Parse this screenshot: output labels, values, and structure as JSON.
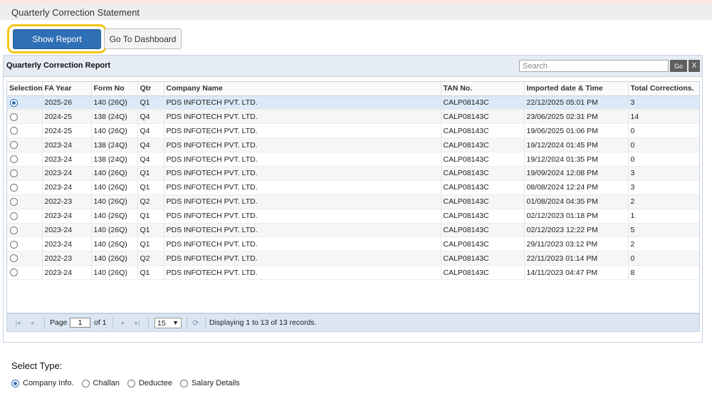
{
  "page": {
    "title": "Quarterly Correction Statement"
  },
  "toolbar": {
    "show_report": "Show Report",
    "go_dashboard": "Go To Dashboard"
  },
  "panel": {
    "title": "Quarterly Correction Report",
    "search_placeholder": "Search",
    "go_label": "Go",
    "clear_label": "X"
  },
  "table": {
    "columns": [
      "Selection",
      "FA Year",
      "Form No",
      "Qtr",
      "Company Name",
      "TAN No.",
      "Imported date & Time",
      "Total Corrections."
    ],
    "rows": [
      {
        "selected": true,
        "fa_year": "2025-26",
        "form_no": "140 (26Q)",
        "qtr": "Q1",
        "company": "PDS INFOTECH PVT. LTD.",
        "tan": "CALP08143C",
        "imported": "22/12/2025 05:01 PM",
        "total": "3"
      },
      {
        "selected": false,
        "fa_year": "2024-25",
        "form_no": "138 (24Q)",
        "qtr": "Q4",
        "company": "PDS INFOTECH PVT. LTD.",
        "tan": "CALP08143C",
        "imported": "23/06/2025 02:31 PM",
        "total": "14"
      },
      {
        "selected": false,
        "fa_year": "2024-25",
        "form_no": "140 (26Q)",
        "qtr": "Q4",
        "company": "PDS INFOTECH PVT. LTD.",
        "tan": "CALP08143C",
        "imported": "19/06/2025 01:06 PM",
        "total": "0"
      },
      {
        "selected": false,
        "fa_year": "2023-24",
        "form_no": "138 (24Q)",
        "qtr": "Q4",
        "company": "PDS INFOTECH PVT. LTD.",
        "tan": "CALP08143C",
        "imported": "19/12/2024 01:45 PM",
        "total": "0"
      },
      {
        "selected": false,
        "fa_year": "2023-24",
        "form_no": "138 (24Q)",
        "qtr": "Q4",
        "company": "PDS INFOTECH PVT. LTD.",
        "tan": "CALP08143C",
        "imported": "19/12/2024 01:35 PM",
        "total": "0"
      },
      {
        "selected": false,
        "fa_year": "2023-24",
        "form_no": "140 (26Q)",
        "qtr": "Q1",
        "company": "PDS INFOTECH PVT. LTD.",
        "tan": "CALP08143C",
        "imported": "19/09/2024 12:08 PM",
        "total": "3"
      },
      {
        "selected": false,
        "fa_year": "2023-24",
        "form_no": "140 (26Q)",
        "qtr": "Q1",
        "company": "PDS INFOTECH PVT. LTD.",
        "tan": "CALP08143C",
        "imported": "08/08/2024 12:24 PM",
        "total": "3"
      },
      {
        "selected": false,
        "fa_year": "2022-23",
        "form_no": "140 (26Q)",
        "qtr": "Q2",
        "company": "PDS INFOTECH PVT. LTD.",
        "tan": "CALP08143C",
        "imported": "01/08/2024 04:35 PM",
        "total": "2"
      },
      {
        "selected": false,
        "fa_year": "2023-24",
        "form_no": "140 (26Q)",
        "qtr": "Q1",
        "company": "PDS INFOTECH PVT. LTD.",
        "tan": "CALP08143C",
        "imported": "02/12/2023 01:18 PM",
        "total": "1"
      },
      {
        "selected": false,
        "fa_year": "2023-24",
        "form_no": "140 (26Q)",
        "qtr": "Q1",
        "company": "PDS INFOTECH PVT. LTD.",
        "tan": "CALP08143C",
        "imported": "02/12/2023 12:22 PM",
        "total": "5"
      },
      {
        "selected": false,
        "fa_year": "2023-24",
        "form_no": "140 (26Q)",
        "qtr": "Q1",
        "company": "PDS INFOTECH PVT. LTD.",
        "tan": "CALP08143C",
        "imported": "29/11/2023 03:12 PM",
        "total": "2"
      },
      {
        "selected": false,
        "fa_year": "2022-23",
        "form_no": "140 (26Q)",
        "qtr": "Q2",
        "company": "PDS INFOTECH PVT. LTD.",
        "tan": "CALP08143C",
        "imported": "22/11/2023 01:14 PM",
        "total": "0"
      },
      {
        "selected": false,
        "fa_year": "2023-24",
        "form_no": "140 (26Q)",
        "qtr": "Q1",
        "company": "PDS INFOTECH PVT. LTD.",
        "tan": "CALP08143C",
        "imported": "14/11/2023 04:47 PM",
        "total": "8"
      }
    ]
  },
  "pager": {
    "page_label": "Page",
    "page_value": "1",
    "of_label": "of 1",
    "page_size": "15",
    "display_text": "Displaying 1 to 13 of 13 records."
  },
  "select_type": {
    "label": "Select Type:",
    "options": [
      {
        "label": "Company Info.",
        "checked": true
      },
      {
        "label": "Challan",
        "checked": false
      },
      {
        "label": "Deductee",
        "checked": false
      },
      {
        "label": "Salary Details",
        "checked": false
      }
    ]
  },
  "colors": {
    "accent": "#2f6fb5",
    "highlight_ring": "#f5c518",
    "panel_header": "#e6ecf4",
    "selected_row": "#dce9f8"
  },
  "icons": [
    "first-page-icon",
    "prev-page-icon",
    "next-page-icon",
    "last-page-icon",
    "refresh-icon",
    "dropdown-caret-icon"
  ]
}
